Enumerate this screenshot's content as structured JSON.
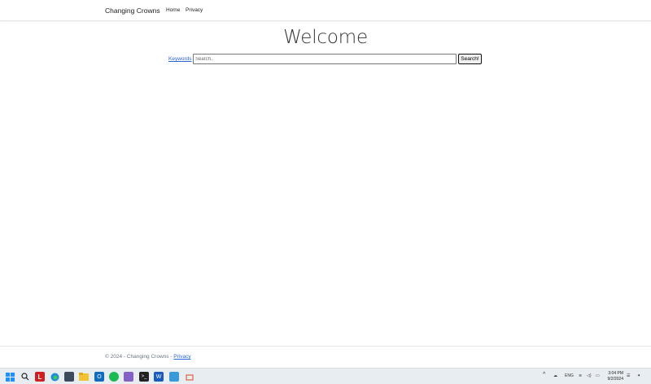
{
  "navbar": {
    "brand": "Changing Crowns",
    "links": [
      "Home",
      "Privacy"
    ]
  },
  "main": {
    "heading": "Welcome",
    "keywords_link": "Keywords",
    "search_placeholder": "Search..",
    "search_button": "Search!"
  },
  "footer": {
    "text": "© 2024 - Changing Crowns - ",
    "privacy_link": "Privacy"
  },
  "taskbar": {
    "icons": [
      "windows-start-icon",
      "search-icon",
      "lastpass-icon",
      "edge-icon",
      "calculator-icon",
      "file-explorer-icon",
      "outlook-icon",
      "spotify-icon",
      "visual-studio-icon",
      "terminal-icon",
      "word-icon",
      "notepad-icon",
      "snipping-tool-icon"
    ],
    "tray": {
      "language": "ENG",
      "time": "3:04 PM",
      "date": "9/2/2024"
    }
  }
}
